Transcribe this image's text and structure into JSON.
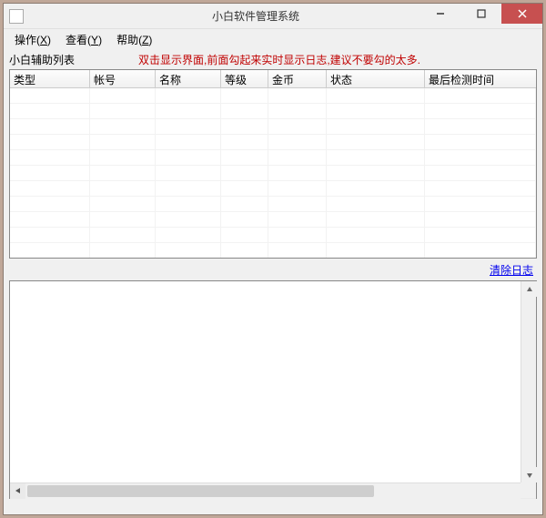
{
  "window": {
    "title": "小白软件管理系统"
  },
  "menu": {
    "operate": "操作",
    "operate_hk": "X",
    "view": "查看",
    "view_hk": "Y",
    "help": "帮助",
    "help_hk": "Z"
  },
  "listview": {
    "label": "小白辅助列表",
    "notice": "双击显示界面,前面勾起来实时显示日志,建议不要勾的太多.",
    "columns": [
      "类型",
      "帐号",
      "名称",
      "等级",
      "金币",
      "状态",
      "最后检测时间"
    ],
    "rows": []
  },
  "log": {
    "clear_link": "清除日志",
    "content": ""
  }
}
